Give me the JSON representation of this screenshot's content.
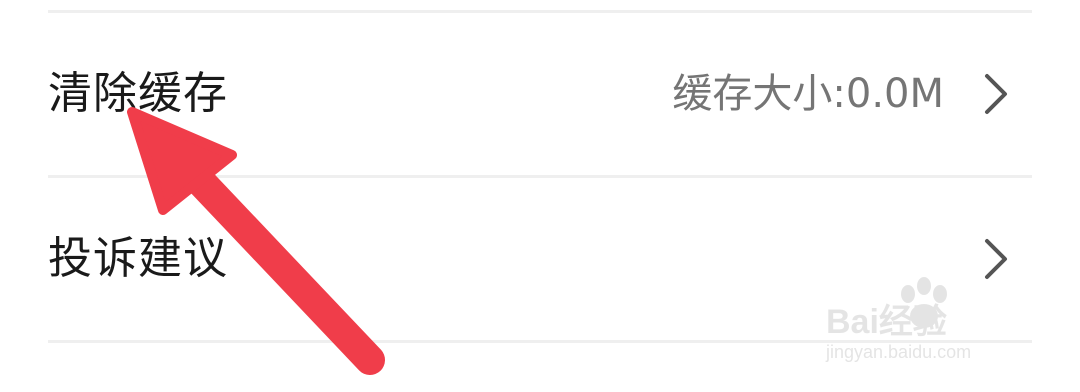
{
  "settings": {
    "rows": [
      {
        "label": "清除缓存",
        "value": "缓存大小:0.0M"
      },
      {
        "label": "投诉建议",
        "value": ""
      }
    ]
  },
  "watermark": {
    "brand": "Bai经验",
    "url": "jingyan.baidu.com"
  },
  "colors": {
    "annotation_arrow": "#f03d4a",
    "divider": "#efefef",
    "label_text": "#1a1a1a",
    "value_text": "#757575",
    "chevron": "#555555"
  }
}
